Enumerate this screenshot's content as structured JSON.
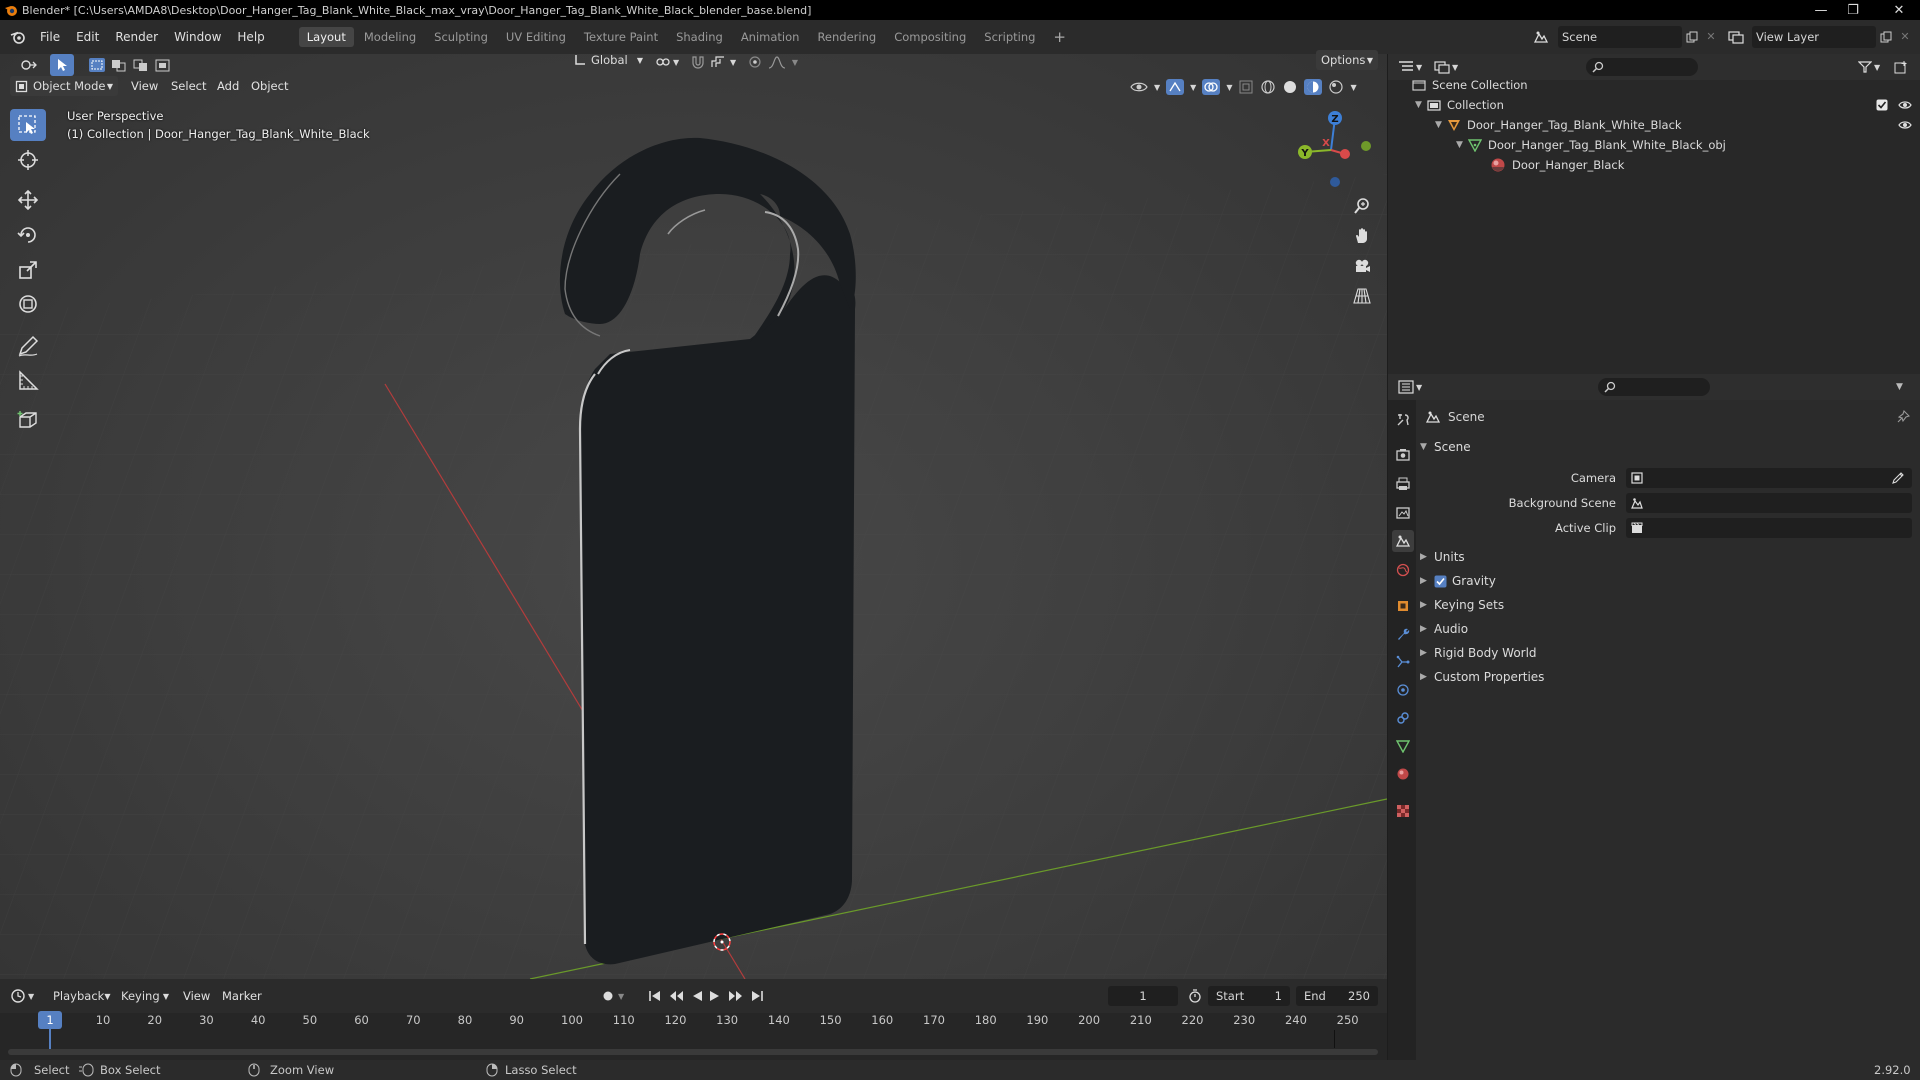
{
  "window": {
    "title": "Blender* [C:\\Users\\AMDA8\\Desktop\\Door_Hanger_Tag_Blank_White_Black_max_vray\\Door_Hanger_Tag_Blank_White_Black_blender_base.blend]",
    "minimize": "—",
    "maximize": "❐",
    "close": "✕"
  },
  "menu": [
    "File",
    "Edit",
    "Render",
    "Window",
    "Help"
  ],
  "workspaces": [
    "Layout",
    "Modeling",
    "Sculpting",
    "UV Editing",
    "Texture Paint",
    "Shading",
    "Animation",
    "Rendering",
    "Compositing",
    "Scripting"
  ],
  "active_workspace": "Layout",
  "add_workspace": "+",
  "scene_selector": "Scene",
  "view_layer": "View Layer",
  "viewport": {
    "mode": "Object Mode",
    "menus": [
      "View",
      "Select",
      "Add",
      "Object"
    ],
    "transform_orientation": "Global",
    "options": "Options",
    "overlay_line1": "User Perspective",
    "overlay_line2": "(1) Collection | Door_Hanger_Tag_Blank_White_Black",
    "gizmo": {
      "z": "Z",
      "y": "Y",
      "x": "X"
    }
  },
  "outliner": {
    "root": "Scene Collection",
    "items": [
      {
        "label": "Collection",
        "level": 1
      },
      {
        "label": "Door_Hanger_Tag_Blank_White_Black",
        "level": 2
      },
      {
        "label": "Door_Hanger_Tag_Blank_White_Black_obj",
        "level": 3
      },
      {
        "label": "Door_Hanger_Black",
        "level": 4
      }
    ]
  },
  "properties": {
    "context": "Scene",
    "panel_title": "Scene",
    "fields": [
      {
        "label": "Camera"
      },
      {
        "label": "Background Scene"
      },
      {
        "label": "Active Clip"
      }
    ],
    "subpanels": [
      {
        "label": "Units",
        "checkbox": false
      },
      {
        "label": "Gravity",
        "checkbox": true
      },
      {
        "label": "Keying Sets",
        "checkbox": false
      },
      {
        "label": "Audio",
        "checkbox": false
      },
      {
        "label": "Rigid Body World",
        "checkbox": false
      },
      {
        "label": "Custom Properties",
        "checkbox": false
      }
    ]
  },
  "timeline": {
    "menus": [
      "Playback",
      "Keying",
      "View",
      "Marker"
    ],
    "current_frame": "1",
    "start_label": "Start",
    "start": "1",
    "end_label": "End",
    "end": "250",
    "ruler": [
      "10",
      "20",
      "30",
      "40",
      "50",
      "60",
      "70",
      "80",
      "90",
      "100",
      "110",
      "120",
      "130",
      "140",
      "150",
      "160",
      "170",
      "180",
      "190",
      "200",
      "210",
      "220",
      "230",
      "240",
      "250"
    ],
    "playhead": "1"
  },
  "status": {
    "select": "Select",
    "box_select": "Box Select",
    "zoom_view": "Zoom View",
    "lasso_select": "Lasso Select",
    "version": "2.92.0"
  }
}
